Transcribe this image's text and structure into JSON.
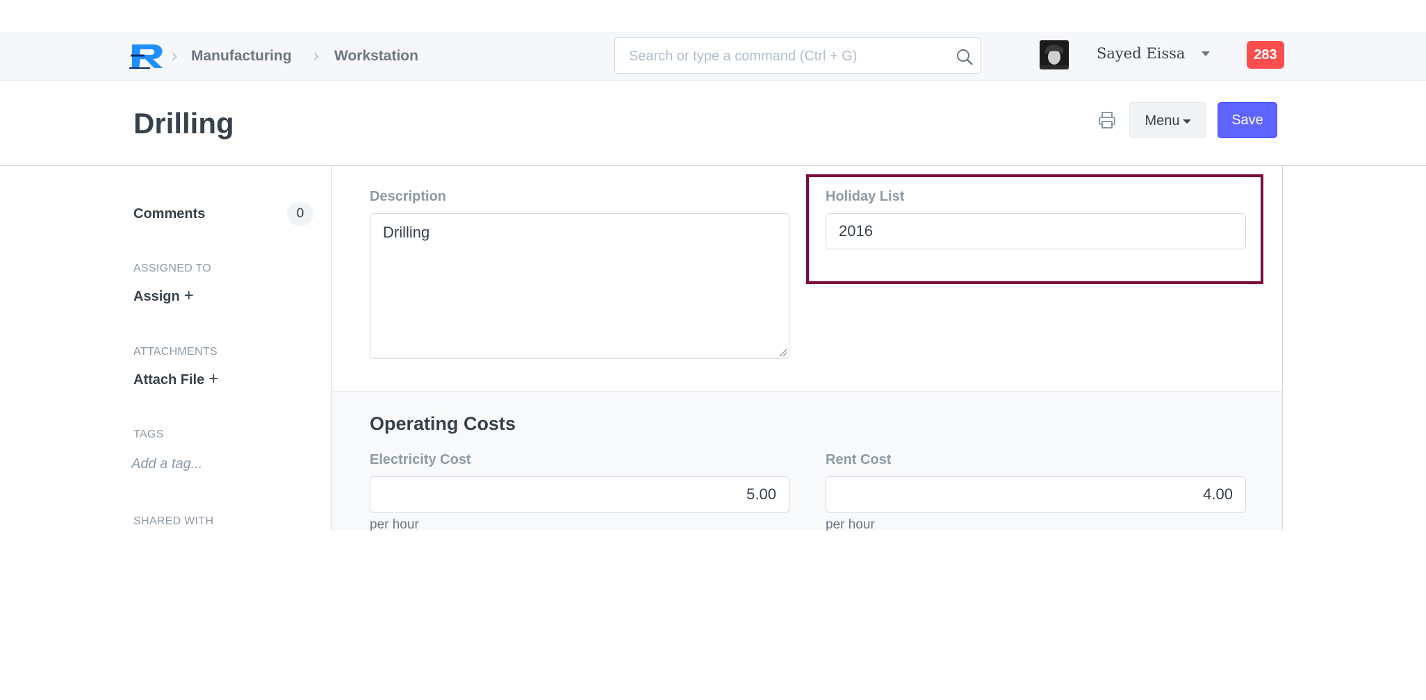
{
  "navbar": {
    "logo_letter": "R",
    "breadcrumbs": [
      "Manufacturing",
      "Workstation"
    ],
    "search_placeholder": "Search or type a command (Ctrl + G)",
    "user_name": "Sayed Eissa",
    "notification_count": "283"
  },
  "page": {
    "title": "Drilling",
    "menu_label": "Menu",
    "save_label": "Save"
  },
  "sidebar": {
    "comments_label": "Comments",
    "comments_count": "0",
    "assigned_to_heading": "ASSIGNED TO",
    "assign_label": "Assign",
    "attachments_heading": "ATTACHMENTS",
    "attach_label": "Attach File",
    "tags_heading": "TAGS",
    "tag_placeholder": "Add a tag...",
    "shared_with_heading": "SHARED WITH"
  },
  "form": {
    "description_label": "Description",
    "description_value": "Drilling",
    "holiday_list_label": "Holiday List",
    "holiday_list_value": "2016",
    "operating_costs_title": "Operating Costs",
    "electricity_cost_label": "Electricity Cost",
    "electricity_cost_value": "5.00",
    "electricity_cost_help": "per hour",
    "rent_cost_label": "Rent Cost",
    "rent_cost_value": "4.00",
    "rent_cost_help": "per hour"
  },
  "colors": {
    "primary": "#5e64ff",
    "notification_badge": "#fc4e4e",
    "highlight_border": "#7d0a3d"
  }
}
